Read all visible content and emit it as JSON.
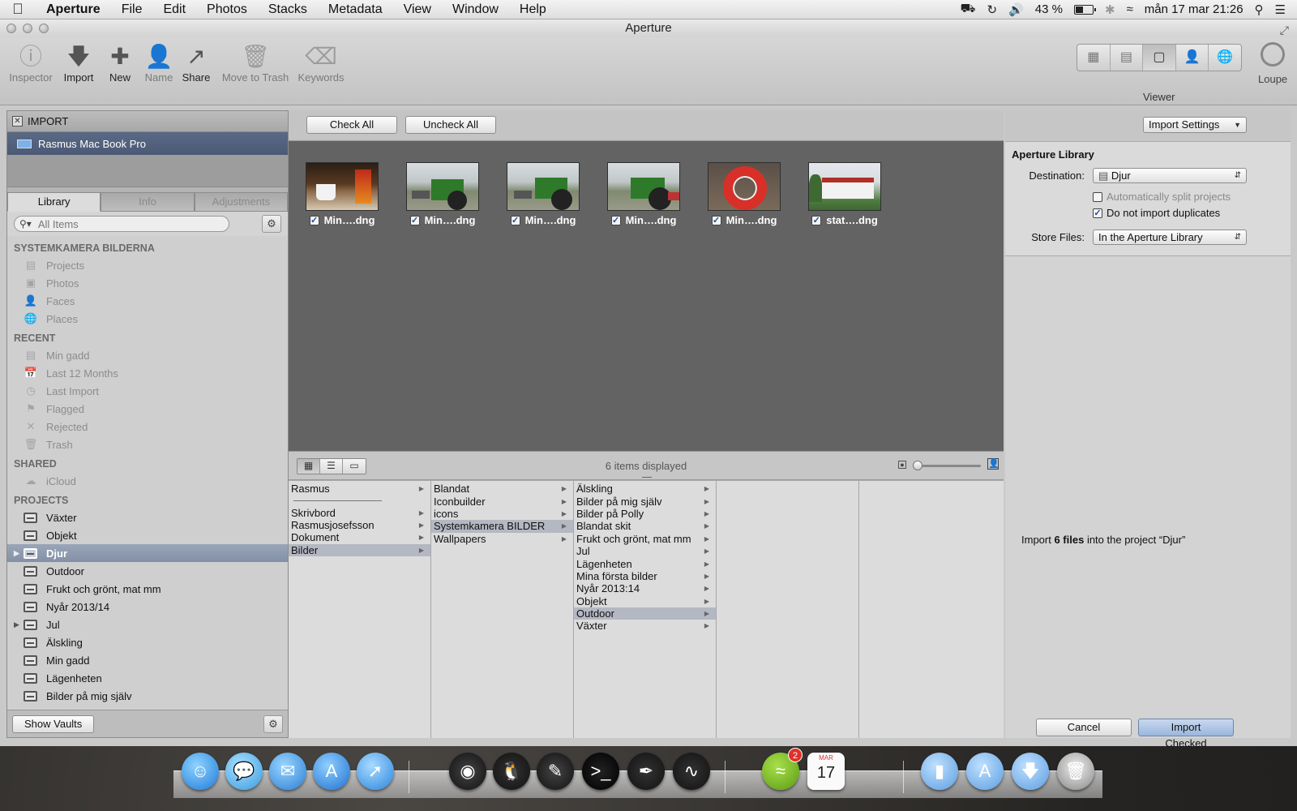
{
  "colors": {
    "selection": "#8390a6",
    "browser_bg": "#636363",
    "import_button": "#9ab7de"
  },
  "menubar": {
    "apple_icon": "apple-icon",
    "app_name": "Aperture",
    "items": [
      "File",
      "Edit",
      "Photos",
      "Stacks",
      "Metadata",
      "View",
      "Window",
      "Help"
    ],
    "battery_percent": "43 %",
    "battery_level": 0.43,
    "datetime": "mån 17 mar  21:26"
  },
  "window": {
    "title": "Aperture"
  },
  "toolbar": {
    "inspector": "Inspector",
    "import": "Import",
    "new": "New",
    "name": "Name",
    "share": "Share",
    "move_to_trash": "Move to Trash",
    "keywords": "Keywords",
    "viewer": "Viewer",
    "loupe": "Loupe"
  },
  "import_panel": {
    "header": "IMPORT",
    "device": "Rasmus Mac Book Pro"
  },
  "library": {
    "tabs": [
      "Library",
      "Info",
      "Adjustments"
    ],
    "active_tab": "Library",
    "search_placeholder": "All Items",
    "sections": {
      "systemkamera": {
        "title": "SYSTEMKAMERA BILDERNA",
        "items": [
          "Projects",
          "Photos",
          "Faces",
          "Places"
        ]
      },
      "recent": {
        "title": "RECENT",
        "items": [
          "Min gadd",
          "Last 12 Months",
          "Last Import",
          "Flagged",
          "Rejected",
          "Trash"
        ]
      },
      "shared": {
        "title": "SHARED",
        "items": [
          "iCloud"
        ]
      },
      "projects": {
        "title": "PROJECTS",
        "items": [
          "Växter",
          "Objekt",
          "Djur",
          "Outdoor",
          "Frukt och grönt, mat mm",
          "Nyår 2013/14",
          "Jul",
          "Älskling",
          "Min gadd",
          "Lägenheten",
          "Bilder på mig själv"
        ],
        "selected": "Djur"
      }
    },
    "show_vaults": "Show Vaults"
  },
  "browser": {
    "check_all": "Check All",
    "uncheck_all": "Uncheck All",
    "thumbnails": [
      {
        "caption": "Min….dng",
        "checked": true,
        "subject": "coffee cup"
      },
      {
        "caption": "Min….dng",
        "checked": true,
        "subject": "tractor"
      },
      {
        "caption": "Min….dng",
        "checked": true,
        "subject": "tractor"
      },
      {
        "caption": "Min….dng",
        "checked": true,
        "subject": "tractor"
      },
      {
        "caption": "Min….dng",
        "checked": true,
        "subject": "lifebuoy"
      },
      {
        "caption": "stat….dng",
        "checked": true,
        "subject": "house"
      }
    ],
    "items_displayed": "6 items displayed",
    "zoom_level": 0.0
  },
  "columns": [
    {
      "rows": [
        "Rasmus",
        "—",
        "Skrivbord",
        "Rasmusjosefsson",
        "Dokument",
        "Bilder"
      ],
      "selected": "Bilder",
      "no_arrow": []
    },
    {
      "rows": [
        "Blandat",
        "Iconbuilder",
        "icons",
        "Systemkamera BILDER",
        "Wallpapers"
      ],
      "selected": "Systemkamera BILDER"
    },
    {
      "rows": [
        "Älskling",
        "Bilder på mig själv",
        "Bilder på Polly",
        "Blandat skit",
        "Frukt och grönt, mat mm",
        "Jul",
        "Lägenheten",
        "Mina första bilder",
        "Nyår 2013:14",
        "Objekt",
        "Outdoor",
        "Växter"
      ],
      "selected": "Outdoor"
    },
    {
      "rows": []
    },
    {
      "rows": []
    }
  ],
  "settings": {
    "import_settings": "Import Settings",
    "library_title": "Aperture Library",
    "destination_label": "Destination:",
    "destination_value": "Djur",
    "auto_split": "Automatically split projects",
    "auto_split_checked": false,
    "no_duplicates": "Do not import duplicates",
    "no_duplicates_checked": true,
    "store_files_label": "Store Files:",
    "store_files_value": "In the Aperture Library",
    "summary_prefix": "Import ",
    "summary_count": "6 files",
    "summary_suffix": " into the project “Djur”",
    "cancel": "Cancel",
    "import_checked": "Import Checked"
  },
  "dock": {
    "spotify_badge": "2",
    "calendar_month": "MAR",
    "calendar_day": "17"
  }
}
